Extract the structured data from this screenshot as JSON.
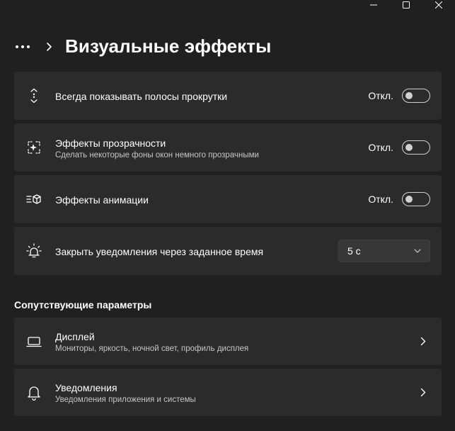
{
  "window": {
    "minimize_icon": "minimize-icon",
    "maximize_icon": "maximize-icon",
    "close_icon": "close-icon"
  },
  "header": {
    "more_icon": "more-icon",
    "chevron_icon": "chevron-right-icon",
    "title": "Визуальные эффекты"
  },
  "settings": [
    {
      "icon": "scrollbar-icon",
      "title": "Всегда показывать полосы прокрутки",
      "state_label": "Откл.",
      "on": false
    },
    {
      "icon": "transparency-icon",
      "title": "Эффекты прозрачности",
      "description": "Сделать некоторые фоны окон немного прозрачными",
      "state_label": "Откл.",
      "on": false
    },
    {
      "icon": "animation-icon",
      "title": "Эффекты анимации",
      "state_label": "Откл.",
      "on": false
    },
    {
      "icon": "notification-timer-icon",
      "title": "Закрыть уведомления через заданное время",
      "dropdown_value": "5 с"
    }
  ],
  "related": {
    "section_title": "Сопутствующие параметры",
    "items": [
      {
        "icon": "display-icon",
        "title": "Дисплей",
        "description": "Мониторы, яркость, ночной свет, профиль дисплея"
      },
      {
        "icon": "bell-icon",
        "title": "Уведомления",
        "description": "Уведомления приложения и системы"
      }
    ]
  },
  "colors": {
    "background": "#202020",
    "card": "#2b2b2b",
    "text": "#ffffff",
    "secondary_text": "#c5c5c5"
  }
}
